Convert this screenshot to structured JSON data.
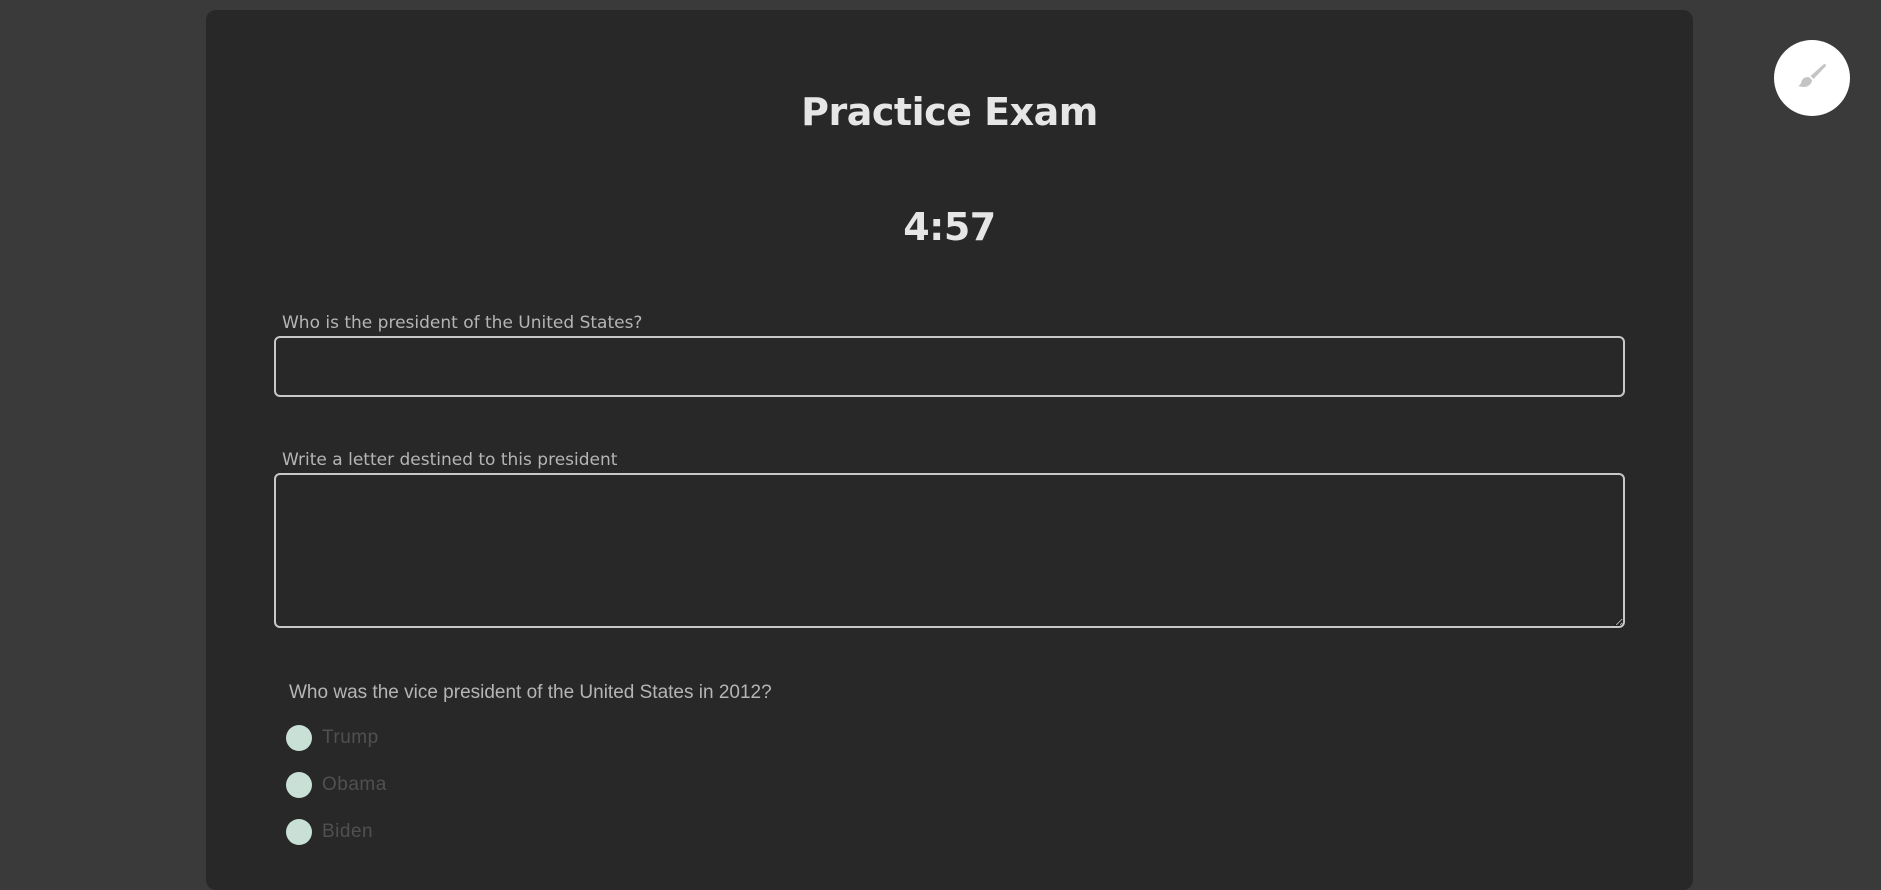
{
  "exam": {
    "title": "Practice Exam",
    "timer": "4:57"
  },
  "questions": {
    "q1": {
      "label": "Who is the president of the United States?",
      "value": ""
    },
    "q2": {
      "label": "Write a letter destined to this president",
      "value": ""
    },
    "q3": {
      "label": "Who was the vice president of the United States in 2012?",
      "options": [
        "Trump",
        "Obama",
        "Biden"
      ]
    }
  },
  "theme_toggle": {
    "icon": "paintbrush-icon"
  },
  "colors": {
    "page_background": "#3a3a3a",
    "card_background": "#282828",
    "heading_text": "#e6e6e6",
    "label_text": "#b5b5b5",
    "input_border": "#c8c8c8",
    "radio_fill": "#c9e0d6",
    "option_text": "#505050",
    "theme_button": "#ffffff"
  }
}
